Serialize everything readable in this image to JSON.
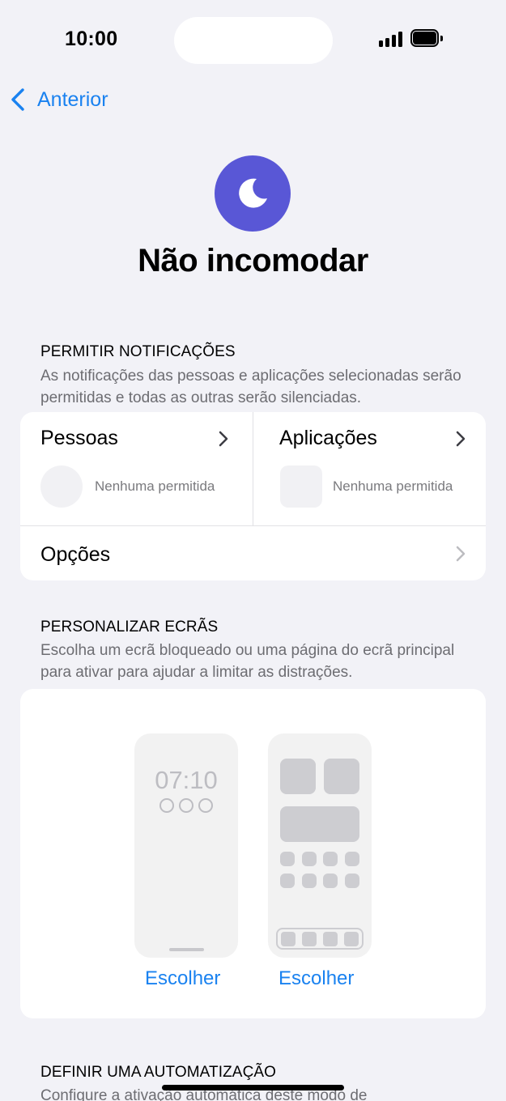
{
  "status_bar": {
    "time": "10:00"
  },
  "nav": {
    "back_label": "Anterior"
  },
  "header": {
    "title": "Não incomodar",
    "icon": "moon-icon",
    "icon_color": "#5957d6"
  },
  "allow_notifications": {
    "heading": "PERMITIR NOTIFICAÇÕES",
    "description": "As notificações das pessoas e aplicações selecionadas serão permitidas e todas as outras serão silenciadas.",
    "people": {
      "title": "Pessoas",
      "status": "Nenhuma permitida"
    },
    "apps": {
      "title": "Aplicações",
      "status": "Nenhuma permitida"
    },
    "options_label": "Opções"
  },
  "customize_screens": {
    "heading": "PERSONALIZAR ECRÃS",
    "description": "Escolha um ecrã bloqueado ou uma página do ecrã principal para ativar para ajudar a limitar as distrações.",
    "lock_screen_time": "07:10",
    "lock_choose_label": "Escolher",
    "home_choose_label": "Escolher"
  },
  "automation": {
    "heading": "DEFINIR UMA AUTOMATIZAÇÃO",
    "description": "Configure a ativação automática deste modo de"
  },
  "colors": {
    "accent": "#1a82f0",
    "background": "#f2f2f7"
  }
}
